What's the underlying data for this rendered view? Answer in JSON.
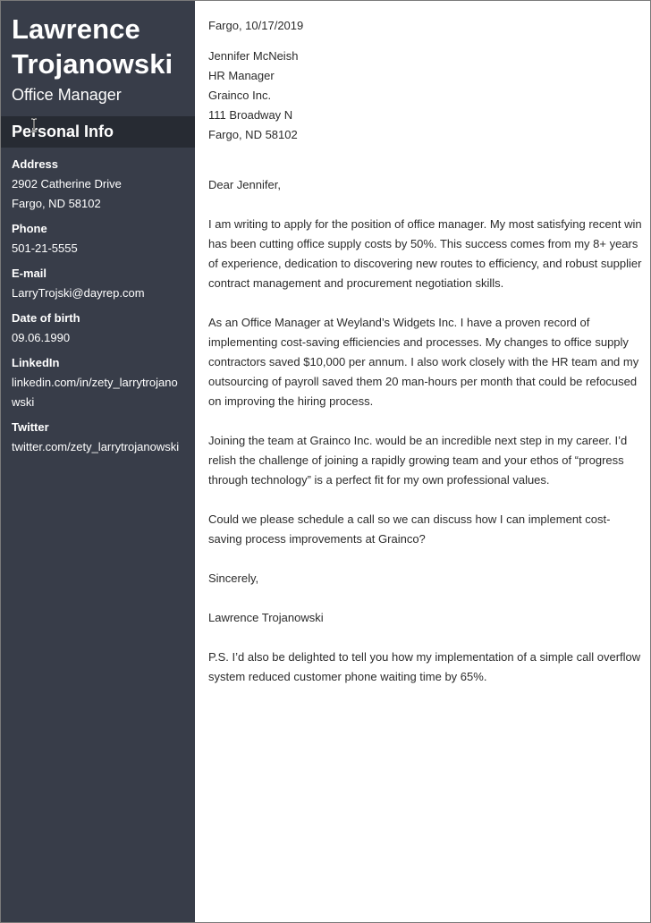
{
  "sidebar": {
    "name_line1": "Lawrence",
    "name_line2": "Trojanowski",
    "role": "Office Manager",
    "section_title": "Personal Info",
    "fields": [
      {
        "label": "Address",
        "values": [
          "2902 Catherine Drive",
          "Fargo, ND 58102"
        ]
      },
      {
        "label": "Phone",
        "values": [
          "501-21-5555"
        ]
      },
      {
        "label": "E-mail",
        "values": [
          "LarryTrojski@dayrep.com"
        ]
      },
      {
        "label": "Date of birth",
        "values": [
          "09.06.1990"
        ]
      },
      {
        "label": "LinkedIn",
        "values": [
          "linkedin.com/in/zety_larrytrojanowski"
        ]
      },
      {
        "label": "Twitter",
        "values": [
          "twitter.com/zety_larrytrojanowski"
        ]
      }
    ]
  },
  "letter": {
    "date": "Fargo, 10/17/2019",
    "recipient": [
      "Jennifer McNeish",
      "HR Manager",
      "Grainco Inc.",
      "111 Broadway N",
      "Fargo, ND 58102"
    ],
    "salutation": "Dear Jennifer,",
    "paragraphs": [
      "I am writing to apply for the position of office manager. My most satisfying recent win has been cutting office supply costs by 50%. This success comes from my 8+ years of experience, dedication to discovering new routes to efficiency, and robust supplier contract management and procurement negotiation skills.",
      "As an Office Manager at Weyland’s Widgets Inc. I have a proven record of implementing cost-saving efficiencies and processes. My changes to office supply contractors saved $10,000 per annum. I also work closely with the HR team and my outsourcing of payroll saved them 20 man-hours per month that could be refocused on improving the hiring process.",
      "Joining the team at Grainco Inc. would be an incredible next step in my career. I’d relish the challenge of joining a rapidly growing team and your ethos of “progress through technology” is a perfect fit for my own professional values.",
      "Could we please schedule a call so we can discuss how I can implement cost-saving process improvements at Grainco?"
    ],
    "closing": "Sincerely,",
    "signature": "Lawrence Trojanowski",
    "postscript": "P.S. I’d also be delighted to tell you how my implementation of a simple call overflow system reduced customer phone waiting time by 65%."
  }
}
